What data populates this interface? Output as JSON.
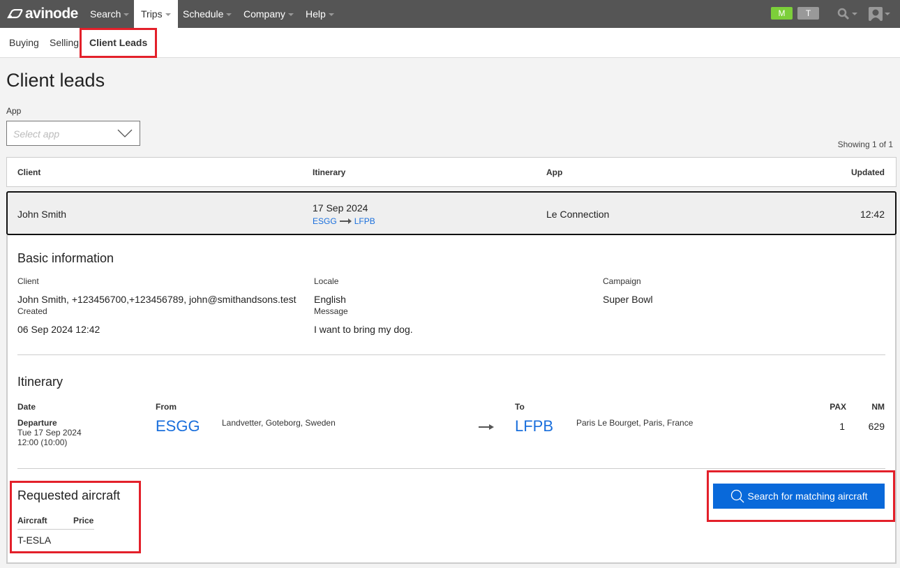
{
  "nav": {
    "brand": "avinode",
    "items": [
      {
        "label": "Search",
        "active": false
      },
      {
        "label": "Trips",
        "active": true
      },
      {
        "label": "Schedule",
        "active": false
      },
      {
        "label": "Company",
        "active": false
      },
      {
        "label": "Help",
        "active": false
      }
    ],
    "badges": {
      "m": "M",
      "t": "T"
    },
    "icons": {
      "search": "search-icon",
      "user": "user-avatar-icon"
    }
  },
  "subnav": {
    "items": [
      {
        "label": "Buying"
      },
      {
        "label": "Selling"
      },
      {
        "label": "Client Leads",
        "active": true
      }
    ]
  },
  "page": {
    "title": "Client leads",
    "app_label": "App",
    "app_placeholder": "Select app",
    "showing": "Showing 1 of 1"
  },
  "table": {
    "headers": {
      "client": "Client",
      "itinerary": "Itinerary",
      "app": "App",
      "updated": "Updated"
    },
    "rows": [
      {
        "client": "John Smith",
        "date": "17 Sep 2024",
        "from": "ESGG",
        "to": "LFPB",
        "app": "Le Connection",
        "updated": "12:42"
      }
    ]
  },
  "basic": {
    "heading": "Basic information",
    "client_label": "Client",
    "client_value": "John Smith, +123456700,+123456789, john@smithandsons.test",
    "locale_label": "Locale",
    "locale_value": "English",
    "campaign_label": "Campaign",
    "campaign_value": "Super Bowl",
    "created_label": "Created",
    "created_value": "06 Sep 2024 12:42",
    "message_label": "Message",
    "message_value": "I want to bring my dog."
  },
  "itinerary": {
    "heading": "Itinerary",
    "headers": {
      "date": "Date",
      "from": "From",
      "to": "To",
      "pax": "PAX",
      "nm": "NM"
    },
    "leg": {
      "type": "Departure",
      "date": "Tue 17 Sep 2024",
      "time": "12:00 (10:00)",
      "from_code": "ESGG",
      "from_name": "Landvetter, Goteborg, Sweden",
      "to_code": "LFPB",
      "to_name": "Paris Le Bourget, Paris, France",
      "pax": "1",
      "nm": "629"
    }
  },
  "requested": {
    "heading": "Requested aircraft",
    "headers": {
      "aircraft": "Aircraft",
      "price": "Price"
    },
    "rows": [
      {
        "aircraft": "T-ESLA",
        "price": ""
      }
    ]
  },
  "actions": {
    "search_label": "Search for matching aircraft"
  },
  "colors": {
    "accent": "#0969da",
    "link": "#1a6fdc",
    "highlight": "#e3202a",
    "nav_bg": "#555555"
  }
}
